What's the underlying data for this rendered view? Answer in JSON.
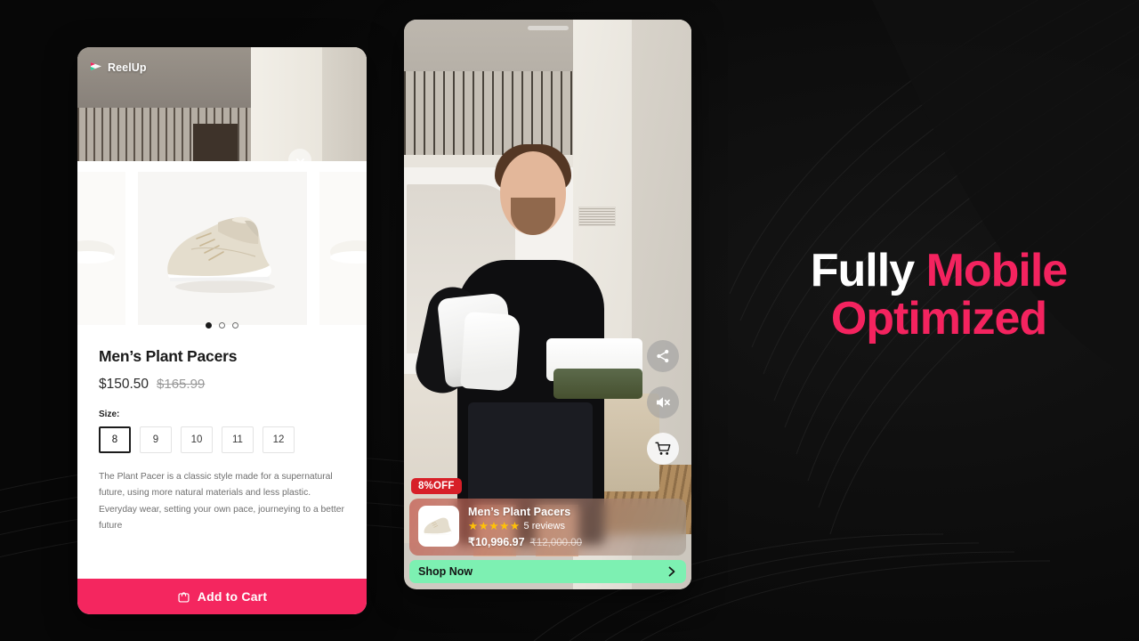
{
  "theme": {
    "background": "#0a0a0a",
    "accent_pink": "#f4235f",
    "badge_red": "#d71f28",
    "shop_now_green": "#7df0b2",
    "star_gold": "#FFC107"
  },
  "headline": {
    "line1_white": "Fully",
    "line1_pink": "Mobile",
    "line2_pink": "Optimized"
  },
  "pdp": {
    "brand_logo_text": "ReelUp",
    "brand_logo_icon": "play-triangle-icon",
    "expand_icon": "chevron-down-icon",
    "carousel": {
      "dots_total": 3,
      "active_dot": 1
    },
    "product_title": "Men’s Plant Pacers",
    "price_current": "$150.50",
    "price_compare": "$165.99",
    "size_label": "Size:",
    "sizes": [
      "8",
      "9",
      "10",
      "11",
      "12"
    ],
    "selected_size": "8",
    "description": "The Plant Pacer is a classic style made for a supernatural future, using more natural materials and less plastic. Everyday wear, setting your own pace, journeying to a better future",
    "add_to_cart_label": "Add to Cart",
    "add_to_cart_icon": "shopping-bag-icon"
  },
  "reel": {
    "actions": [
      {
        "name": "share-icon",
        "label": "Share"
      },
      {
        "name": "mute-icon",
        "label": "Mute"
      },
      {
        "name": "cart-icon",
        "label": "Cart"
      }
    ],
    "discount_badge": "8%OFF",
    "product_title": "Men’s Plant Pacers",
    "stars": "★★★★★",
    "reviews": "5 reviews",
    "price_current": "₹10,996.97",
    "price_compare": "₹12,000.00",
    "shop_now_label": "Shop Now",
    "shop_now_icon": "chevron-right-icon"
  }
}
